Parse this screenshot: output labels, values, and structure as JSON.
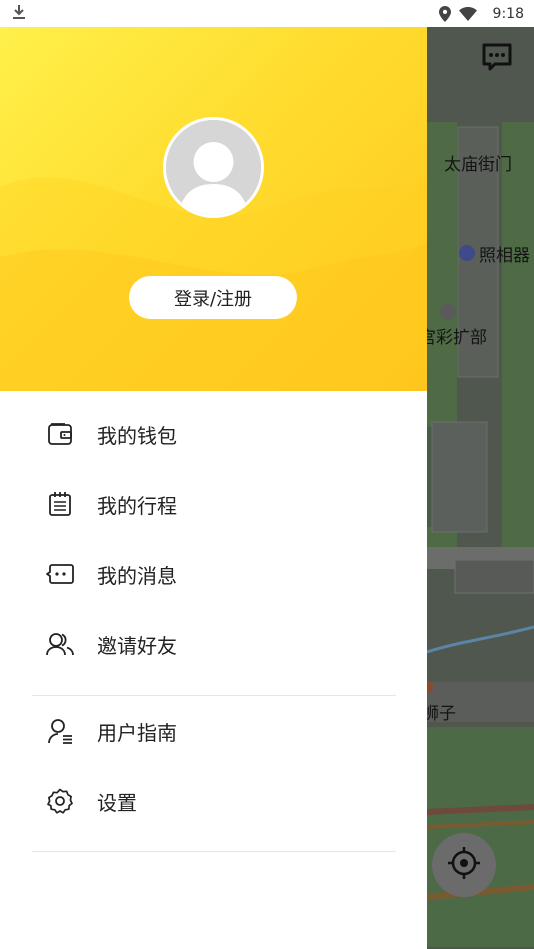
{
  "status_bar": {
    "time": "9:18",
    "icons": [
      "download-icon",
      "location-pin-icon",
      "wifi-icon",
      "battery-icon"
    ]
  },
  "drawer": {
    "login_label": "登录/注册",
    "avatar_icon": "default-avatar-icon",
    "menu": [
      {
        "id": "wallet",
        "label": "我的钱包",
        "icon": "wallet-icon"
      },
      {
        "id": "trips",
        "label": "我的行程",
        "icon": "calendar-list-icon"
      },
      {
        "id": "messages",
        "label": "我的消息",
        "icon": "message-icon"
      },
      {
        "id": "invite",
        "label": "邀请好友",
        "icon": "users-icon"
      },
      {
        "id": "guide",
        "label": "用户指南",
        "icon": "user-guide-icon"
      },
      {
        "id": "settings",
        "label": "设置",
        "icon": "gear-icon"
      }
    ]
  },
  "map": {
    "labels": [
      "太庙街门",
      "照相器",
      "宫彩扩部",
      "狮子"
    ]
  },
  "colors": {
    "header_yellow_light": "#fff04a",
    "header_yellow_dark": "#ffc61f",
    "scrim": "rgba(0,0,0,0.6)"
  }
}
